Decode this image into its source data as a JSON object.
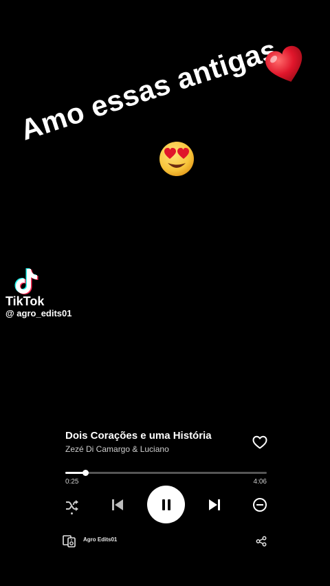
{
  "overlay": {
    "caption": "Amo essas antigas",
    "emojis": [
      "red-heart-emoji",
      "heart-eyes-emoji"
    ]
  },
  "watermark": {
    "app_name": "TikTok",
    "username": "@ agro_edits01"
  },
  "player": {
    "title": "Dois Corações e uma História",
    "artist": "Zezé Di Camargo & Luciano",
    "elapsed": "0:25",
    "duration": "4:06",
    "progress": 0.1,
    "is_playing": true,
    "shuffle_active": true,
    "device_label": "Agro Edits01",
    "icons": [
      "heart-outline-icon",
      "shuffle-icon",
      "previous-icon",
      "pause-icon",
      "next-icon",
      "remove-icon",
      "connect-device-icon",
      "share-icon"
    ]
  },
  "colors": {
    "background": "#000000",
    "text": "#ffffff",
    "secondary_text": "#cfcfcf",
    "track": "#555555",
    "heart_red": "#e0162b",
    "emoji_yellow": "#f7c43a"
  }
}
